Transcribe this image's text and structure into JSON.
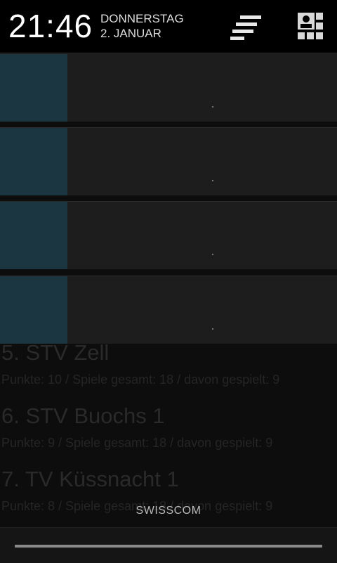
{
  "status": {
    "time": "21:46",
    "day": "DONNERSTAG",
    "date": "2. JANUAR"
  },
  "icons": {
    "settings": "quick-settings-icon",
    "profile": "user-profile-icon"
  },
  "background_list": {
    "items": [
      {
        "title": "5. STV Zell",
        "subtitle": "Punkte: 10 / Spiele gesamt: 18 / davon gespielt: 9"
      },
      {
        "title": "6. STV Buochs 1",
        "subtitle": "Punkte: 9 / Spiele gesamt: 18 / davon gespielt: 9"
      },
      {
        "title": "7. TV Küssnacht 1",
        "subtitle": "Punkte: 8 / Spiele gesamt: 18 / davon gespielt: 9"
      }
    ]
  },
  "notifications": [
    {
      "id": 1
    },
    {
      "id": 2
    },
    {
      "id": 3
    },
    {
      "id": 4
    }
  ],
  "carrier": "SWISSCOM",
  "colors": {
    "notification_icon": "#1b3640",
    "notification_bg": "#1d1d1d",
    "header_bg": "#000000"
  }
}
